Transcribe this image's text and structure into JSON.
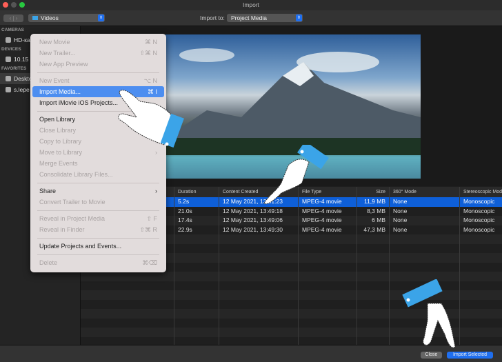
{
  "window": {
    "title": "Import"
  },
  "toolbar": {
    "source": "Videos",
    "import_to_label": "Import to:",
    "import_to_value": "Project Media"
  },
  "sidebar": {
    "sections": [
      {
        "header": "CAMERAS",
        "items": [
          {
            "label": "HD-ка",
            "icon": "camera-icon"
          }
        ]
      },
      {
        "header": "DEVICES",
        "items": [
          {
            "label": "10.15",
            "icon": "disk-icon"
          }
        ]
      },
      {
        "header": "FAVORITES",
        "items": [
          {
            "label": "Deskto",
            "icon": "desktop-icon",
            "selected": true
          },
          {
            "label": "s.lepe",
            "icon": "home-icon"
          }
        ]
      }
    ]
  },
  "menu": {
    "groups": [
      [
        {
          "label": "New Movie",
          "shortcut": "⌘ N",
          "disabled": true
        },
        {
          "label": "New Trailer...",
          "shortcut": "⇧⌘ N",
          "disabled": true
        },
        {
          "label": "New App Preview",
          "shortcut": "",
          "disabled": true
        }
      ],
      [
        {
          "label": "New Event",
          "shortcut": "⌥ N",
          "disabled": true
        },
        {
          "label": "Import Media...",
          "shortcut": "⌘ I",
          "highlighted": true
        },
        {
          "label": "Import iMovie iOS Projects...",
          "shortcut": ""
        }
      ],
      [
        {
          "label": "Open Library",
          "shortcut": ""
        },
        {
          "label": "Close Library",
          "shortcut": "",
          "disabled": true
        },
        {
          "label": "Copy to Library",
          "shortcut": "›",
          "disabled": true
        },
        {
          "label": "Move to Library",
          "shortcut": "›",
          "disabled": true
        },
        {
          "label": "Merge Events",
          "shortcut": "",
          "disabled": true
        },
        {
          "label": "Consolidate Library Files...",
          "shortcut": "",
          "disabled": true
        }
      ],
      [
        {
          "label": "Share",
          "shortcut": "›"
        },
        {
          "label": "Convert Trailer to Movie",
          "shortcut": "",
          "disabled": true
        }
      ],
      [
        {
          "label": "Reveal in Project Media",
          "shortcut": "⇧ F",
          "disabled": true
        },
        {
          "label": "Reveal in Finder",
          "shortcut": "⇧⌘ R",
          "disabled": true
        }
      ],
      [
        {
          "label": "Update Projects and Events...",
          "shortcut": ""
        }
      ],
      [
        {
          "label": "Delete",
          "shortcut": "⌘⌫",
          "disabled": true
        }
      ]
    ]
  },
  "table": {
    "columns": [
      "",
      "Duration",
      "Content Created",
      "File Type",
      "Size",
      "360° Mode",
      "Stereoscopic Mode"
    ],
    "rows": [
      [
        "...",
        "5.2s",
        "12 May 2021, 13:51:23",
        "MPEG-4 movie",
        "11,9 MB",
        "None",
        "Monoscopic"
      ],
      [
        "...",
        "21.0s",
        "12 May 2021, 13:49:18",
        "MPEG-4 movie",
        "8,3 MB",
        "None",
        "Monoscopic"
      ],
      [
        "...",
        "17.4s",
        "12 May 2021, 13:49:06",
        "MPEG-4 movie",
        "6 MB",
        "None",
        "Monoscopic"
      ],
      [
        "...",
        "22.9s",
        "12 May 2021, 13:49:30",
        "MPEG-4 movie",
        "47,3 MB",
        "None",
        "Monoscopic"
      ]
    ],
    "selected_row": 0,
    "empty_rows": 12
  },
  "footer": {
    "close": "Close",
    "import_selected": "Import Selected"
  },
  "colors": {
    "accent": "#1f6ff0",
    "selection": "#0e5fd8",
    "menu_highlight": "#4d8ef0",
    "hand_cuff": "#3ba4e8"
  }
}
